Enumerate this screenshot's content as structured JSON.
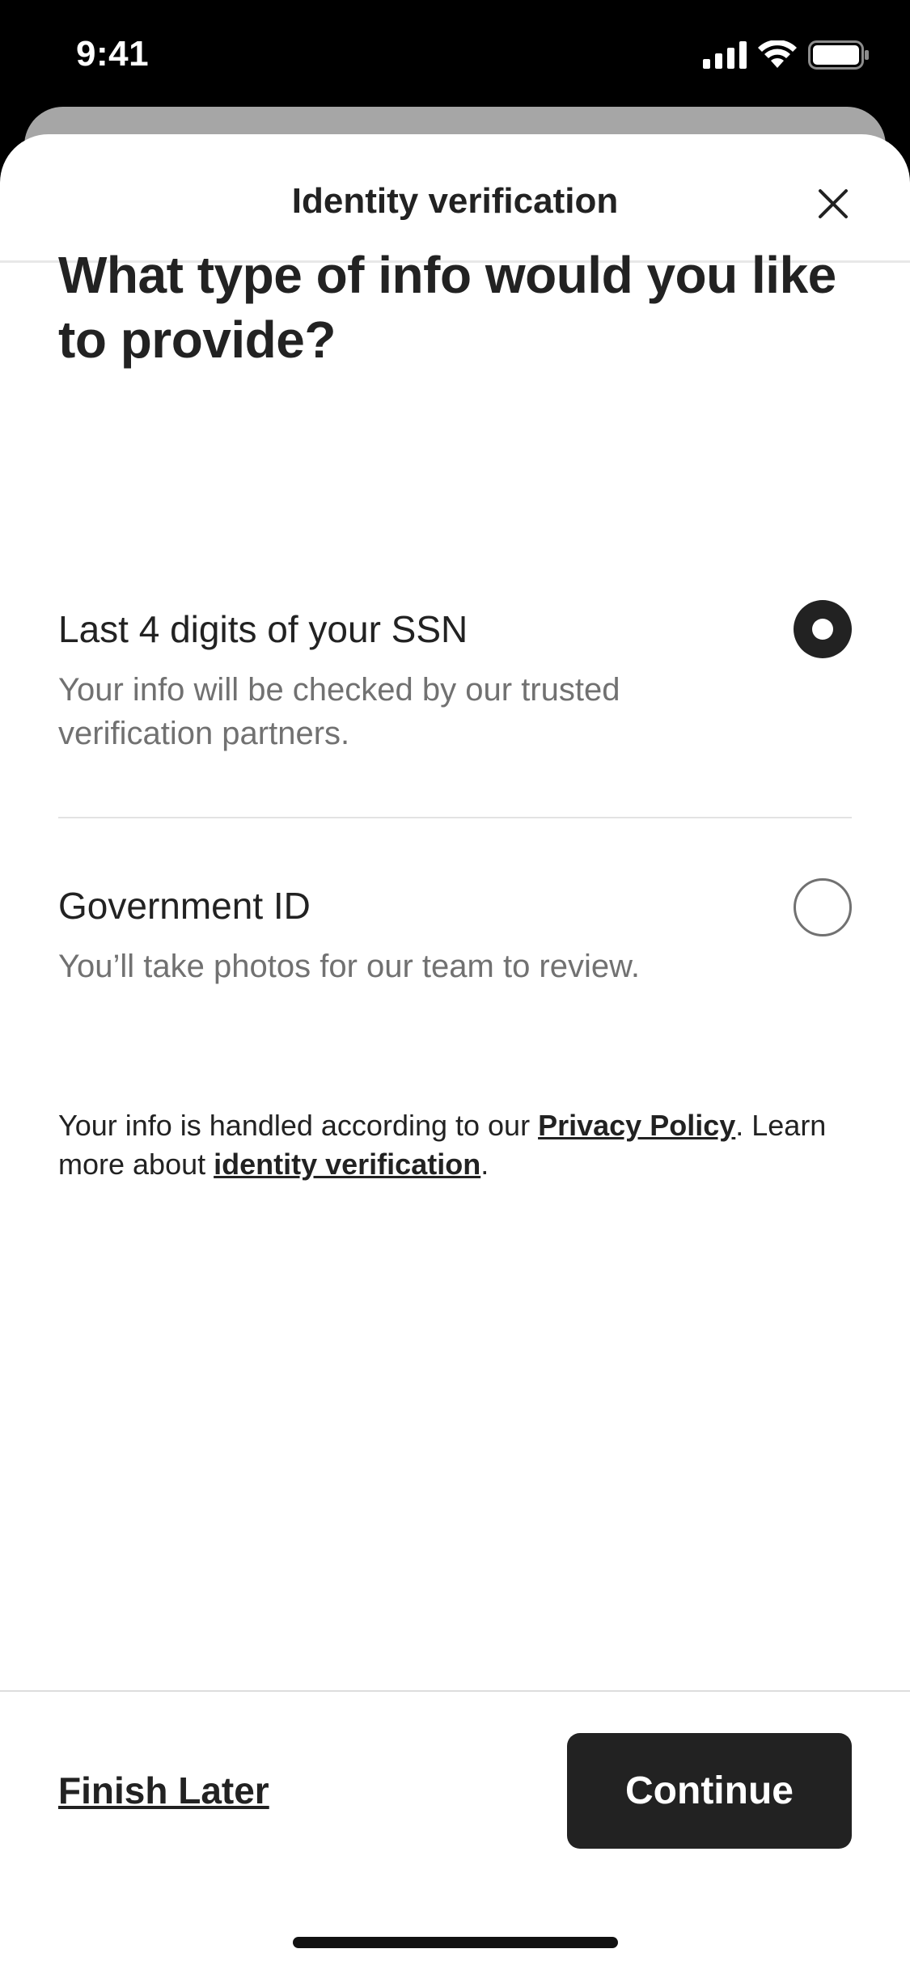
{
  "status_bar": {
    "time": "9:41",
    "icons": [
      "cellular-signal-icon",
      "wifi-icon",
      "battery-icon"
    ]
  },
  "header": {
    "title": "Identity verification",
    "close_icon": "close-icon"
  },
  "question": "What type of info would you like to provide?",
  "options": [
    {
      "title": "Last 4 digits of your SSN",
      "description": "Your info will be checked by our trusted verification partners.",
      "selected": true
    },
    {
      "title": "Government ID",
      "description": "You’ll take photos for our team to review.",
      "selected": false
    }
  ],
  "legal": {
    "text_1": "Your info is handled according to our ",
    "privacy_link": "Privacy Policy",
    "text_2": ". Learn more about ",
    "identity_link": "identity verification",
    "text_3": "."
  },
  "footer": {
    "finish_later": "Finish Later",
    "continue": "Continue"
  },
  "colors": {
    "primary": "#222222",
    "secondary_text": "#717171",
    "background": "#ffffff"
  }
}
